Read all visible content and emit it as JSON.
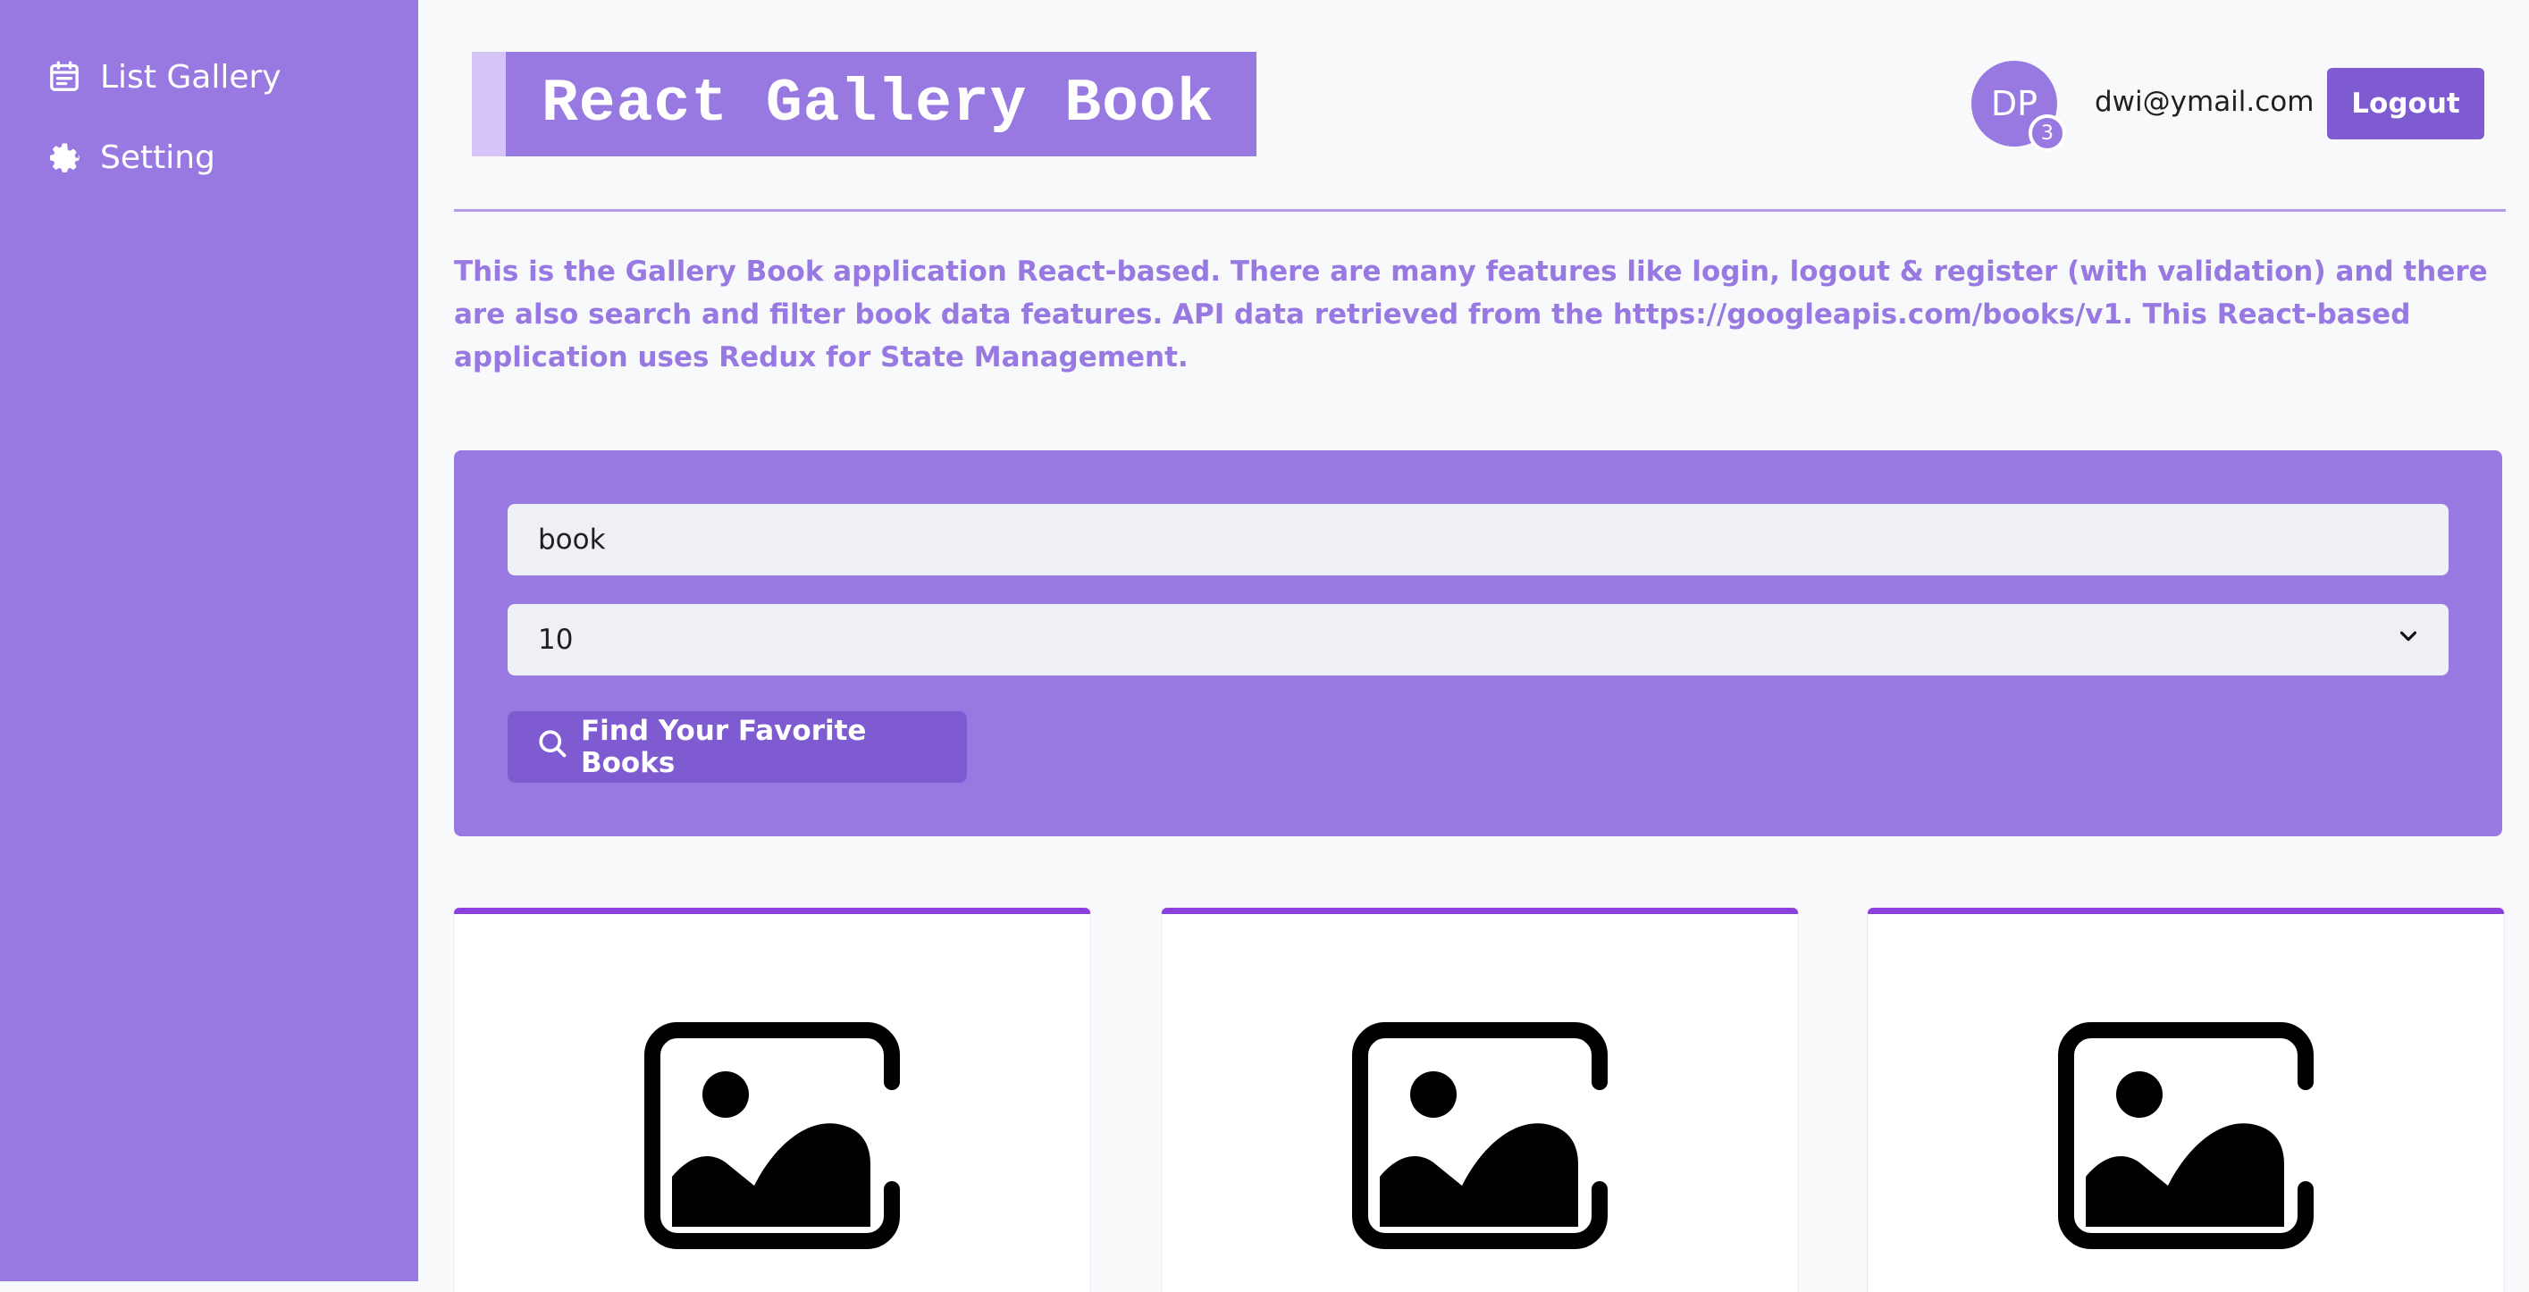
{
  "sidebar": {
    "items": [
      {
        "label": "List Gallery",
        "icon": "calendar-list-icon"
      },
      {
        "label": "Setting",
        "icon": "gear-icon"
      }
    ]
  },
  "header": {
    "title": "React Gallery Book",
    "avatar_initials": "DP",
    "notification_count": "3",
    "user_email": "dwi@ymail.com",
    "logout_label": "Logout"
  },
  "description": "This is the Gallery Book application React-based. There are many features like login, logout & register (with validation) and there are also search and filter book data features. API data retrieved from the https://googleapis.com/books/v1. This React-based application uses Redux for State Management.",
  "search": {
    "query": "book",
    "results_per_page": "10",
    "button_label": "Find Your Favorite Books"
  },
  "cards": [
    {
      "image": "image-placeholder-icon"
    },
    {
      "image": "image-placeholder-icon"
    },
    {
      "image": "image-placeholder-icon"
    }
  ],
  "colors": {
    "sidebar": "#9879e2",
    "accent_dark": "#7e5bd0",
    "card_top_border": "#8b3fdc",
    "title_accent": "#d5c5f7"
  }
}
